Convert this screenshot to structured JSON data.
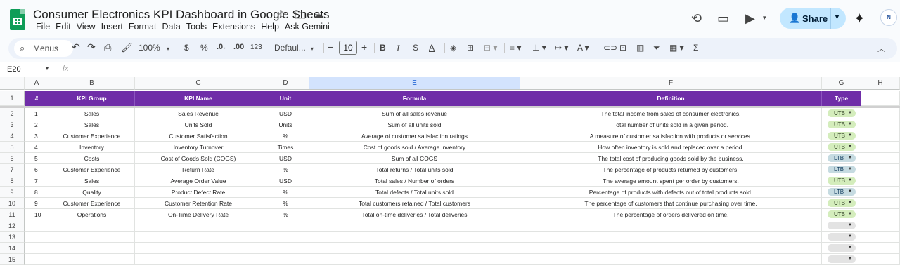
{
  "app": {
    "title": "Consumer Electronics KPI Dashboard in Google Sheets",
    "menu": [
      "File",
      "Edit",
      "View",
      "Insert",
      "Format",
      "Data",
      "Tools",
      "Extensions",
      "Help",
      "Ask Gemini"
    ],
    "share_label": "Share",
    "avatar_initials": "N"
  },
  "toolbar": {
    "menus_label": "Menus",
    "zoom": "100%",
    "currency": "$",
    "percent": "%",
    "dec_dec": ".0",
    "dec_inc": ".00",
    "number_format": "123",
    "font": "Defaul...",
    "font_size": "10"
  },
  "formula_bar": {
    "name_box": "E20",
    "fx": "fx"
  },
  "columns": [
    "A",
    "B",
    "C",
    "D",
    "E",
    "F",
    "G",
    "H"
  ],
  "header": [
    "#",
    "KPI Group",
    "KPI Name",
    "Unit",
    "Formula",
    "Definition",
    "Type"
  ],
  "rows": [
    {
      "n": "1",
      "group": "Sales",
      "name": "Sales Revenue",
      "unit": "USD",
      "formula": "Sum of all sales revenue",
      "definition": "The total income from sales of consumer electronics.",
      "type": "UTB"
    },
    {
      "n": "2",
      "group": "Sales",
      "name": "Units Sold",
      "unit": "Units",
      "formula": "Sum of all units sold",
      "definition": "Total number of units sold in a given period.",
      "type": "UTB"
    },
    {
      "n": "3",
      "group": "Customer Experience",
      "name": "Customer Satisfaction",
      "unit": "%",
      "formula": "Average of customer satisfaction ratings",
      "definition": "A measure of customer satisfaction with products or services.",
      "type": "UTB"
    },
    {
      "n": "4",
      "group": "Inventory",
      "name": "Inventory Turnover",
      "unit": "Times",
      "formula": "Cost of goods sold / Average inventory",
      "definition": "How often inventory is sold and replaced over a period.",
      "type": "UTB"
    },
    {
      "n": "5",
      "group": "Costs",
      "name": "Cost of Goods Sold (COGS)",
      "unit": "USD",
      "formula": "Sum of all COGS",
      "definition": "The total cost of producing goods sold by the business.",
      "type": "LTB"
    },
    {
      "n": "6",
      "group": "Customer Experience",
      "name": "Return Rate",
      "unit": "%",
      "formula": "Total returns / Total units sold",
      "definition": "The percentage of products returned by customers.",
      "type": "LTB"
    },
    {
      "n": "7",
      "group": "Sales",
      "name": "Average Order Value",
      "unit": "USD",
      "formula": "Total sales / Number of orders",
      "definition": "The average amount spent per order by customers.",
      "type": "UTB"
    },
    {
      "n": "8",
      "group": "Quality",
      "name": "Product Defect Rate",
      "unit": "%",
      "formula": "Total defects / Total units sold",
      "definition": "Percentage of products with defects out of total products sold.",
      "type": "LTB"
    },
    {
      "n": "9",
      "group": "Customer Experience",
      "name": "Customer Retention Rate",
      "unit": "%",
      "formula": "Total customers retained / Total customers",
      "definition": "The percentage of customers that continue purchasing over time.",
      "type": "UTB"
    },
    {
      "n": "10",
      "group": "Operations",
      "name": "On-Time Delivery Rate",
      "unit": "%",
      "formula": "Total on-time deliveries / Total deliveries",
      "definition": "The percentage of orders delivered on time.",
      "type": "UTB"
    }
  ],
  "row_numbers": [
    "1",
    "2",
    "3",
    "4",
    "5",
    "6",
    "7",
    "8",
    "9",
    "10",
    "11",
    "12",
    "13",
    "14",
    "15"
  ]
}
